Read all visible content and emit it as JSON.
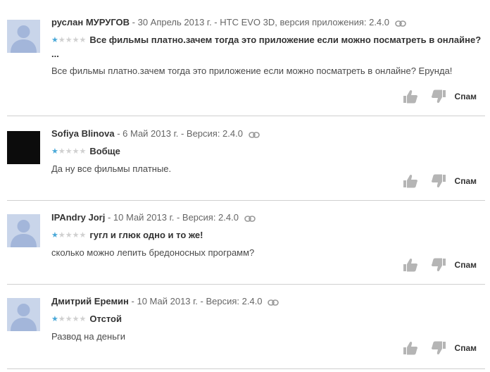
{
  "reviews": [
    {
      "author": "руслан МУРУГОВ",
      "meta": " - 30 Апрель 2013 г. - HTC EVO 3D, версия приложения: 2.4.0",
      "rating": 1,
      "title": "Все фильмы платно.зачем тогда это приложение если можно посматреть в онлайне? ...",
      "body": "Все фильмы платно.зачем тогда это приложение если можно посматреть в онлайне? Ерунда!",
      "avatar": "default",
      "spam_label": "Спам"
    },
    {
      "author": "Sofiya Blinova",
      "meta": " - 6 Май 2013 г. - Версия: 2.4.0",
      "rating": 1,
      "title": "Вобще",
      "body": "Да ну все фильмы платные.",
      "avatar": "dark",
      "spam_label": "Спам"
    },
    {
      "author": "IPAndry Jorj",
      "meta": " - 10 Май 2013 г. - Версия: 2.4.0",
      "rating": 1,
      "title": "гугл и глюк одно и то же!",
      "body": "сколько можно лепить бредоносных программ?",
      "avatar": "default",
      "spam_label": "Спам"
    },
    {
      "author": "Дмитрий Еремин",
      "meta": " - 10 Май 2013 г. - Версия: 2.4.0",
      "rating": 1,
      "title": "Отстой",
      "body": "Развод на деньги",
      "avatar": "default",
      "spam_label": "Спам"
    }
  ],
  "colors": {
    "star_on": "#4aa9d8",
    "star_off": "#d0d0d0",
    "avatar_bg": "#c9d5ea",
    "divider": "#cfcfcf"
  }
}
